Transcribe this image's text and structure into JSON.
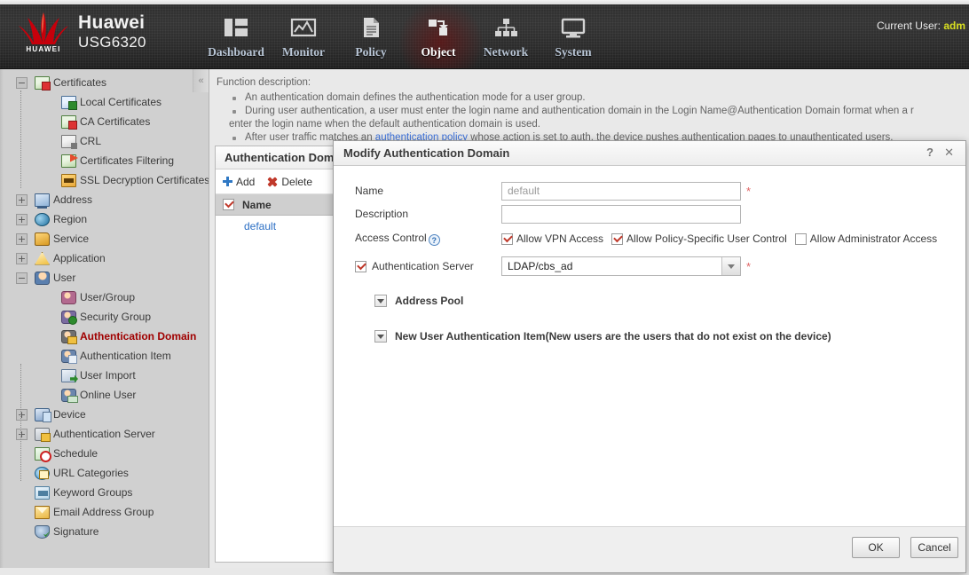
{
  "header": {
    "brand_line1": "Huawei",
    "brand_line2": "USG6320",
    "logo_text": "HUAWEI",
    "current_user_label": "Current User:",
    "current_user_name": "adm",
    "accent_red": "#c7000b",
    "nav": [
      {
        "label": "Dashboard",
        "icon": "dashboard-icon",
        "active": false
      },
      {
        "label": "Monitor",
        "icon": "monitor-icon",
        "active": false
      },
      {
        "label": "Policy",
        "icon": "policy-icon",
        "active": false
      },
      {
        "label": "Object",
        "icon": "object-icon",
        "active": true
      },
      {
        "label": "Network",
        "icon": "network-icon",
        "active": false
      },
      {
        "label": "System",
        "icon": "system-icon",
        "active": false
      }
    ]
  },
  "sidebar": {
    "collapse_glyph": "«",
    "items": [
      {
        "label": "Certificates",
        "level": 0,
        "toggle": "minus",
        "icon": "certificate-icon",
        "selected": false
      },
      {
        "label": "Local Certificates",
        "level": 2,
        "toggle": "none",
        "icon": "local-certificate-icon",
        "selected": false
      },
      {
        "label": "CA Certificates",
        "level": 2,
        "toggle": "none",
        "icon": "ca-certificate-icon",
        "selected": false
      },
      {
        "label": "CRL",
        "level": 2,
        "toggle": "none",
        "icon": "crl-icon",
        "selected": false
      },
      {
        "label": "Certificates Filtering",
        "level": 2,
        "toggle": "none",
        "icon": "certificate-filter-icon",
        "selected": false
      },
      {
        "label": "SSL Decryption Certificates",
        "level": 2,
        "toggle": "none",
        "icon": "ssl-certificate-icon",
        "selected": false
      },
      {
        "label": "Address",
        "level": 0,
        "toggle": "plus",
        "icon": "address-icon",
        "selected": false
      },
      {
        "label": "Region",
        "level": 0,
        "toggle": "plus",
        "icon": "region-globe-icon",
        "selected": false
      },
      {
        "label": "Service",
        "level": 0,
        "toggle": "plus",
        "icon": "service-folder-icon",
        "selected": false
      },
      {
        "label": "Application",
        "level": 0,
        "toggle": "plus",
        "icon": "application-icon",
        "selected": false
      },
      {
        "label": "User",
        "level": 0,
        "toggle": "minus",
        "icon": "user-icon",
        "selected": false
      },
      {
        "label": "User/Group",
        "level": 2,
        "toggle": "none",
        "icon": "user-group-icon",
        "selected": false
      },
      {
        "label": "Security Group",
        "level": 2,
        "toggle": "none",
        "icon": "security-group-icon",
        "selected": false
      },
      {
        "label": "Authentication Domain",
        "level": 2,
        "toggle": "none",
        "icon": "authentication-domain-icon",
        "selected": true
      },
      {
        "label": "Authentication Item",
        "level": 2,
        "toggle": "none",
        "icon": "authentication-item-icon",
        "selected": false
      },
      {
        "label": "User Import",
        "level": 2,
        "toggle": "none",
        "icon": "user-import-icon",
        "selected": false
      },
      {
        "label": "Online User",
        "level": 2,
        "toggle": "none",
        "icon": "online-user-icon",
        "selected": false
      },
      {
        "label": "Device",
        "level": 0,
        "toggle": "plus",
        "icon": "device-icon",
        "selected": false
      },
      {
        "label": "Authentication Server",
        "level": 0,
        "toggle": "plus",
        "icon": "authentication-server-icon",
        "selected": false
      },
      {
        "label": "Schedule",
        "level": 0,
        "toggle": "none",
        "icon": "schedule-icon",
        "selected": false
      },
      {
        "label": "URL Categories",
        "level": 0,
        "toggle": "none",
        "icon": "url-categories-icon",
        "selected": false
      },
      {
        "label": "Keyword Groups",
        "level": 0,
        "toggle": "none",
        "icon": "keyword-groups-icon",
        "selected": false
      },
      {
        "label": "Email Address Group",
        "level": 0,
        "toggle": "none",
        "icon": "email-address-group-icon",
        "selected": false
      },
      {
        "label": "Signature",
        "level": 0,
        "toggle": "none",
        "icon": "signature-icon",
        "selected": false
      }
    ]
  },
  "function_description": {
    "title": "Function description:",
    "bullets": [
      "An authentication domain defines the authentication mode for a user group.",
      "During user authentication, a user must enter the login name and authentication domain in the Login Name@Authentication Domain format when a r",
      "After user traffic matches an "
    ],
    "bullet2_continuation": "enter the login name when the default authentication domain is used.",
    "bullet3_link": "authentication policy",
    "bullet3_tail": " whose action is set to auth, the device pushes authentication pages to unauthenticated users."
  },
  "panel": {
    "title": "Authentication Dom",
    "toolbar": {
      "add_label": "Add",
      "delete_label": "Delete"
    },
    "grid": {
      "header_checkbox_checked": true,
      "columns": [
        "Name"
      ],
      "rows": [
        {
          "name": "default"
        }
      ]
    }
  },
  "dialog": {
    "title": "Modify Authentication Domain",
    "help_glyph": "?",
    "close_glyph": "✕",
    "fields": {
      "name_label": "Name",
      "name_value": "",
      "name_placeholder": "default",
      "name_required": "*",
      "description_label": "Description",
      "description_value": "",
      "description_placeholder": "",
      "access_control_label": "Access Control",
      "access_control_help": "?",
      "access_control_options": [
        {
          "label": "Allow VPN Access",
          "checked": true
        },
        {
          "label": "Allow Policy-Specific User Control",
          "checked": true
        },
        {
          "label": "Allow Administrator Access",
          "checked": false
        }
      ],
      "authentication_server_label": "Authentication Server",
      "authentication_server_checked": true,
      "authentication_server_value": "LDAP/cbs_ad",
      "authentication_server_required": "*"
    },
    "sections": [
      {
        "label": "Address Pool",
        "expanded": false
      },
      {
        "label": "New User Authentication Item(New users are the users that do not exist on the device)",
        "expanded": false
      }
    ],
    "footer": {
      "ok_label": "OK",
      "cancel_label": "Cancel"
    }
  }
}
